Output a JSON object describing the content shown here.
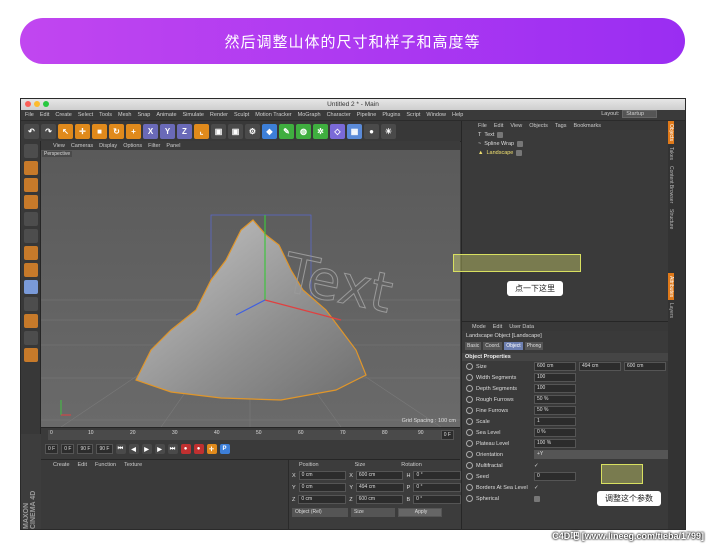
{
  "banner": {
    "text": "然后调整山体的尺寸和样子和高度等"
  },
  "window": {
    "title": "Untitled 2 * - Main"
  },
  "menubar": [
    "File",
    "Edit",
    "Create",
    "Select",
    "Tools",
    "Mesh",
    "Snap",
    "Animate",
    "Simulate",
    "Render",
    "Sculpt",
    "Motion Tracker",
    "MoGraph",
    "Character",
    "Pipeline",
    "Plugins",
    "Script",
    "Window",
    "Help"
  ],
  "layout": {
    "label": "Layout:",
    "value": "Startup"
  },
  "viewport": {
    "menu": [
      "View",
      "Cameras",
      "Display",
      "Options",
      "Filter",
      "Panel"
    ],
    "label": "Perspective",
    "grid_spacing": "Grid Spacing : 100 cm",
    "text3d": "Text"
  },
  "timeline": {
    "ticks": [
      "0",
      "10",
      "20",
      "30",
      "40",
      "50",
      "60",
      "70",
      "80",
      "90"
    ],
    "current_frame": "0 F",
    "start": "0 F",
    "range_a": "0 F",
    "range_b": "90 F",
    "end": "90 F",
    "end2": "0 F"
  },
  "materials": {
    "menu": [
      "Create",
      "Edit",
      "Function",
      "Texture"
    ]
  },
  "coords": {
    "headers": [
      "Position",
      "Size",
      "Rotation"
    ],
    "rows": [
      {
        "axis": "X",
        "pos": "0 cm",
        "size_axis": "X",
        "size": "600 cm",
        "rot_axis": "H",
        "rot": "0 °"
      },
      {
        "axis": "Y",
        "pos": "0 cm",
        "size_axis": "Y",
        "size": "494 cm",
        "rot_axis": "P",
        "rot": "0 °"
      },
      {
        "axis": "Z",
        "pos": "0 cm",
        "size_axis": "Z",
        "size": "600 cm",
        "rot_axis": "B",
        "rot": "0 °"
      }
    ],
    "mode": "Object (Rel)",
    "size_mode": "Size",
    "apply": "Apply"
  },
  "objects": {
    "menu": [
      "File",
      "Edit",
      "View",
      "Objects",
      "Tags",
      "Bookmarks"
    ],
    "items": [
      {
        "name": "Text",
        "selected": false
      },
      {
        "name": "Spline Wrap",
        "selected": false
      },
      {
        "name": "Landscape",
        "selected": true
      }
    ]
  },
  "callout1": "点一下这里",
  "callout2": "调整这个参数",
  "attributes": {
    "menu": [
      "Mode",
      "Edit",
      "User Data"
    ],
    "title": "Landscape Object [Landscape]",
    "tabs": [
      "Basic",
      "Coord.",
      "Object",
      "Phong"
    ],
    "active_tab": "Object",
    "section": "Object Properties",
    "rows": [
      {
        "label": "Size",
        "value": "600 cm",
        "value2": "494 cm",
        "value3": "600 cm"
      },
      {
        "label": "Width Segments",
        "value": "100"
      },
      {
        "label": "Depth Segments",
        "value": "100"
      },
      {
        "label": "Rough Furrows",
        "value": "50 %"
      },
      {
        "label": "Fine Furrows",
        "value": "50 %"
      },
      {
        "label": "Scale",
        "value": "1"
      },
      {
        "label": "Sea Level",
        "value": "0 %"
      },
      {
        "label": "Plateau Level",
        "value": "100 %"
      },
      {
        "label": "Orientation",
        "value": "+Y"
      },
      {
        "label": "Multifractal",
        "value": "✓"
      },
      {
        "label": "Seed",
        "value": "0"
      },
      {
        "label": "Borders At Sea Level",
        "value": "✓"
      },
      {
        "label": "Spherical",
        "value": ""
      }
    ]
  },
  "sidetabs": [
    "Objects",
    "Takes",
    "Content Browser",
    "Structure",
    "Attributes",
    "Layers"
  ],
  "logo": "MAXON CINEMA 4D",
  "watermark": "C4D吧 [www.lineeg.com/tieba/1799]"
}
